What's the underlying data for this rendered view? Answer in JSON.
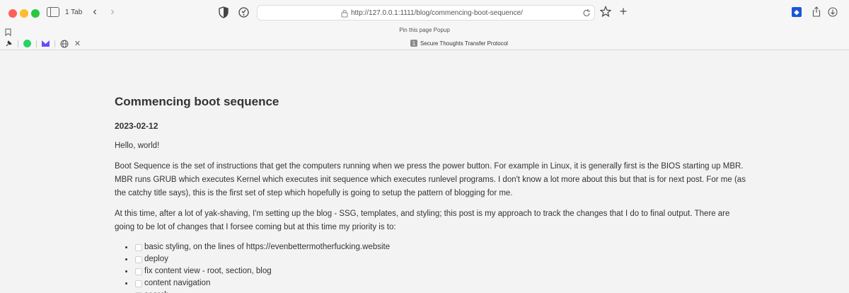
{
  "browser": {
    "tab_count_label": "1 Tab",
    "url": "http://127.0.0.1:1111/blog/commencing-boot-sequence/",
    "pin_popup_label": "Pin this page Popup",
    "active_tab": {
      "index": "1",
      "title": "Secure Thoughts Transfer Protocol"
    },
    "traffic_colors": {
      "close": "#ff5f57",
      "minimize": "#febc2e",
      "zoom": "#28c840"
    },
    "pinned_icons": [
      "pin-icon",
      "whatsapp-icon",
      "proton-mail-icon",
      "globe-icon",
      "close-icon"
    ],
    "toolbar_icons": [
      "sidebar-icon",
      "back-icon",
      "forward-icon",
      "shield-icon",
      "extension-icon",
      "lock-icon",
      "reload-icon",
      "star-icon",
      "plus-icon",
      "bitwarden-icon",
      "share-icon",
      "download-icon"
    ]
  },
  "article": {
    "title": "Commencing boot sequence",
    "date": "2023-02-12",
    "paragraphs": [
      "Hello, world!",
      "Boot Sequence is the set of instructions that get the computers running when we press the power button. For example in Linux, it is generally first is the BIOS starting up MBR. MBR runs GRUB which executes Kernel which executes init sequence which executes runlevel programs. I don't know a lot more about this but that is for next post. For me (as the catchy title says), this is the first set of step which hopefully is going to setup the pattern of blogging for me.",
      "At this time, after a lot of yak-shaving, I'm setting up the blog - SSG, templates, and styling; this post is my approach to track the changes that I do to final output. There are going to be lot of changes that I forsee coming but at this time my priority is to:"
    ],
    "todos": [
      "basic styling, on the lines of https://evenbettermotherfucking.website",
      "deploy",
      "fix content view - root, section, blog",
      "content navigation",
      "search"
    ]
  }
}
